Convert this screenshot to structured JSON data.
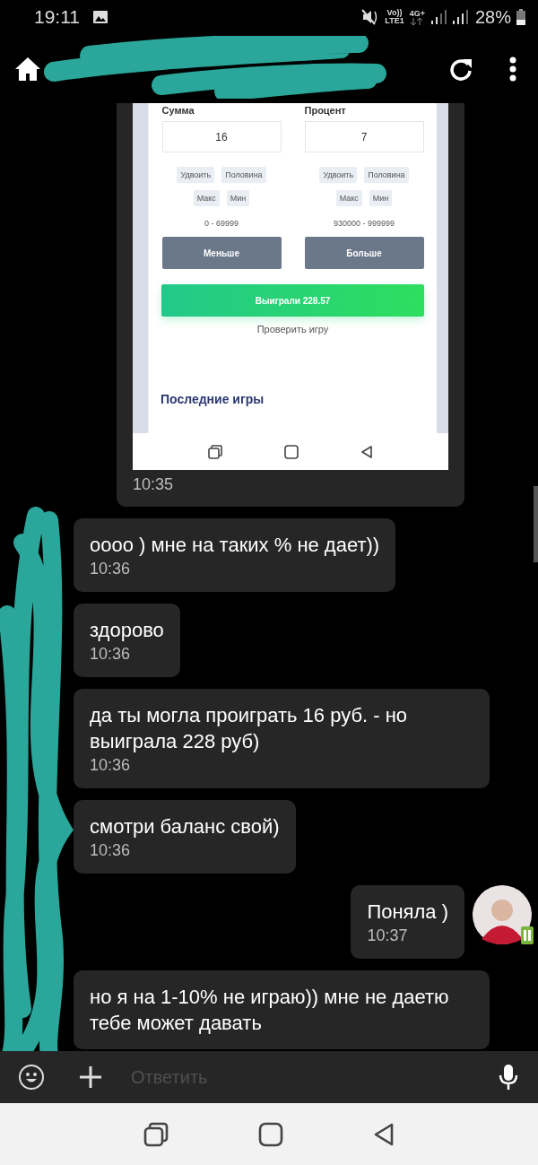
{
  "status_bar": {
    "time": "19:11",
    "volte": "Vo))",
    "lte": "LTE1",
    "network": "4G+",
    "battery": "28%"
  },
  "chat": {
    "shared_image": {
      "time": "10:35",
      "screen": {
        "columns": [
          {
            "label": "Сумма",
            "value": "16",
            "chips": [
              "Удвоить",
              "Половина",
              "Макс",
              "Мин"
            ],
            "range": "0 - 69999",
            "button": "Меньше"
          },
          {
            "label": "Процент",
            "value": "7",
            "chips": [
              "Удвоить",
              "Половина",
              "Макс",
              "Мин"
            ],
            "range": "930000 - 999999",
            "button": "Больше"
          }
        ],
        "result_button": "Выиграли 228.57",
        "check_link": "Проверить игру",
        "section_title": "Последние игры"
      }
    },
    "messages": [
      {
        "kind": "incoming",
        "text": "оооо ) мне на таких % не дает))",
        "time": "10:36"
      },
      {
        "kind": "incoming",
        "text": "здорово",
        "time": "10:36"
      },
      {
        "kind": "incoming",
        "text": "да ты могла проиграть 16 руб. - но выиграла 228 руб)",
        "time": "10:36"
      },
      {
        "kind": "incoming",
        "text": "смотри баланс свой)",
        "time": "10:36"
      },
      {
        "kind": "outgoing",
        "text": "Поняла )",
        "time": "10:37"
      },
      {
        "kind": "incoming",
        "text": "но я на 1-10% не играю)) мне не даетю тебе может давать"
      }
    ]
  },
  "composer": {
    "placeholder": "Ответить"
  }
}
